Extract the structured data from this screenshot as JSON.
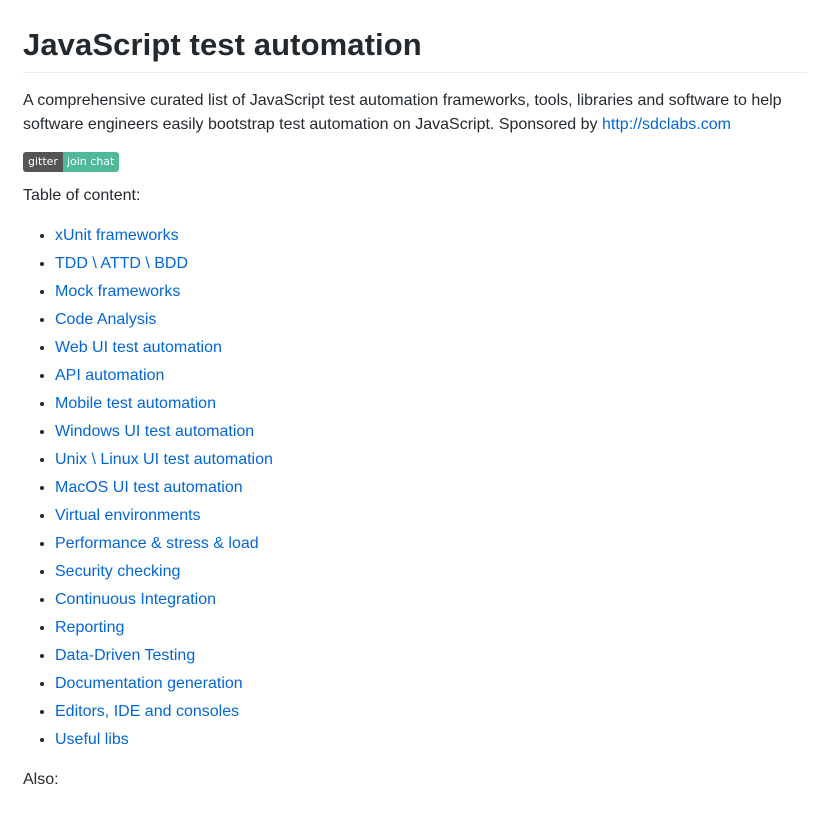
{
  "readme": {
    "title": "JavaScript test automation",
    "intro_text": "A comprehensive curated list of JavaScript test automation frameworks, tools, libraries and software to help software engineers easily bootstrap test automation on JavaScript. Sponsored by ",
    "sponsor_link": "http://sdclabs.com",
    "badge": {
      "left": "gitter",
      "right": "join chat",
      "left_color": "#555555",
      "right_color": "#4fb999"
    },
    "toc_label": "Table of content:",
    "toc_items": [
      "xUnit frameworks",
      "TDD \\ ATTD \\ BDD",
      "Mock frameworks",
      "Code Analysis",
      "Web UI test automation",
      "API automation",
      "Mobile test automation",
      "Windows UI test automation",
      "Unix \\ Linux UI test automation",
      "MacOS UI test automation",
      "Virtual environments",
      "Performance & stress & load",
      "Security checking",
      "Continuous Integration",
      "Reporting",
      "Data-Driven Testing",
      "Documentation generation",
      "Editors, IDE and consoles",
      "Useful libs"
    ],
    "also_label": "Also:",
    "link_color": "#0366d6",
    "text_color": "#24292e"
  }
}
